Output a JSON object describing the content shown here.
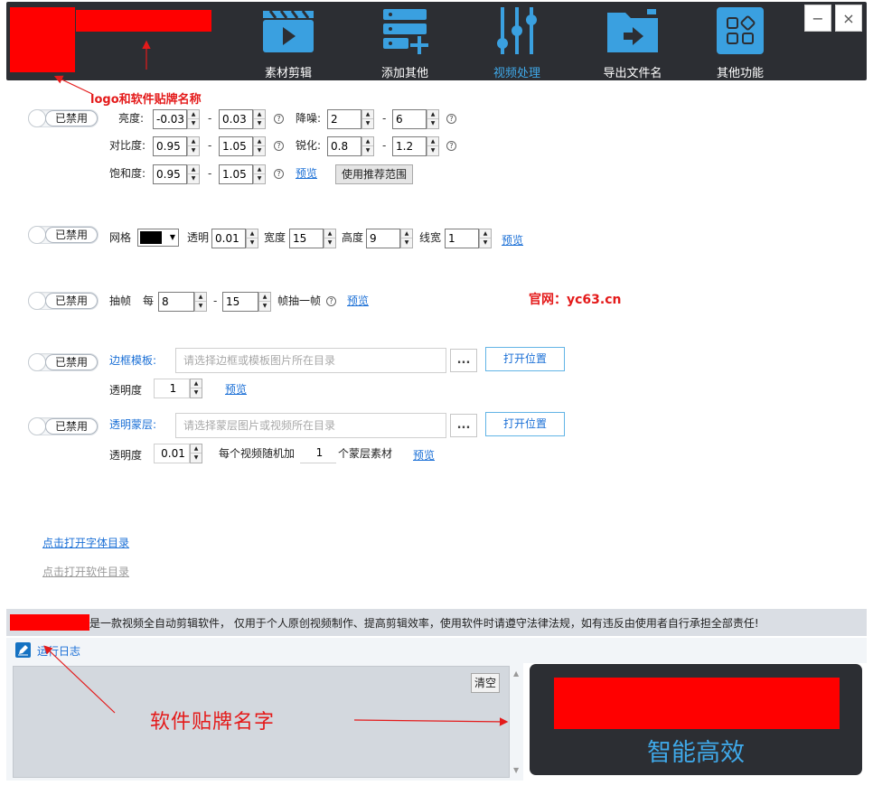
{
  "nav": [
    {
      "label": "素材剪辑",
      "icon": "clapperboard-icon"
    },
    {
      "label": "添加其他",
      "icon": "server-add-icon"
    },
    {
      "label": "视频处理",
      "icon": "sliders-icon"
    },
    {
      "label": "导出文件名",
      "icon": "folder-export-icon"
    },
    {
      "label": "其他功能",
      "icon": "grid-apps-icon"
    }
  ],
  "window": {
    "minimize": "−",
    "close": "×"
  },
  "annotations": {
    "logo_note": "logo和软件贴牌名称",
    "brand_name_note": "软件贴牌名字",
    "website": "官网：yc63.cn"
  },
  "toggle_label": "已禁用",
  "color_section": {
    "brightness_label": "亮度:",
    "brightness_min": "-0.03",
    "brightness_max": "0.03",
    "denoise_label": "降噪:",
    "denoise_min": "2",
    "denoise_max": "6",
    "contrast_label": "对比度:",
    "contrast_min": "0.95",
    "contrast_max": "1.05",
    "sharpen_label": "锐化:",
    "sharpen_min": "0.8",
    "sharpen_max": "1.2",
    "saturation_label": "饱和度:",
    "saturation_min": "0.95",
    "saturation_max": "1.05",
    "preview": "预览",
    "recommend_btn": "使用推荐范围"
  },
  "grid_section": {
    "grid_label": "网格",
    "grid_color": "#000000",
    "opacity_label": "透明",
    "opacity": "0.01",
    "width_label": "宽度",
    "width": "15",
    "height_label": "高度",
    "height": "9",
    "line_label": "线宽",
    "line_width": "1",
    "preview": "预览"
  },
  "frame_section": {
    "label": "抽帧",
    "every": "每",
    "min": "8",
    "max": "15",
    "suffix": "帧抽一帧",
    "preview": "预览"
  },
  "border_section": {
    "label": "边框模板:",
    "placeholder": "请选择边框或模板图片所在目录",
    "open_btn": "打开位置",
    "dots": "...",
    "opacity_label": "透明度",
    "opacity": "1",
    "preview": "预览"
  },
  "overlay_section": {
    "label": "透明蒙层:",
    "placeholder": "请选择蒙层图片或视频所在目录",
    "open_btn": "打开位置",
    "dots": "...",
    "opacity_label": "透明度",
    "opacity": "0.01",
    "random_prefix": "每个视频随机加",
    "random_count": "1",
    "random_suffix": "个蒙层素材",
    "preview": "预览"
  },
  "links": {
    "font_dir": "点击打开字体目录",
    "app_dir": "点击打开软件目录"
  },
  "disclaimer": "是一款视频全自动剪辑软件， 仅用于个人原创视频制作、提高剪辑效率，使用软件时请遵守法律法规，如有违反由使用者自行承担全部责任!",
  "log": {
    "title": "运行日志",
    "clear": "清空"
  },
  "promo_text": "智能高效",
  "colors": {
    "titlebar": "#2c2e33",
    "accent": "#3fa8e8",
    "annotation": "#e41a1a",
    "placeholder_block": "#ff0000"
  }
}
